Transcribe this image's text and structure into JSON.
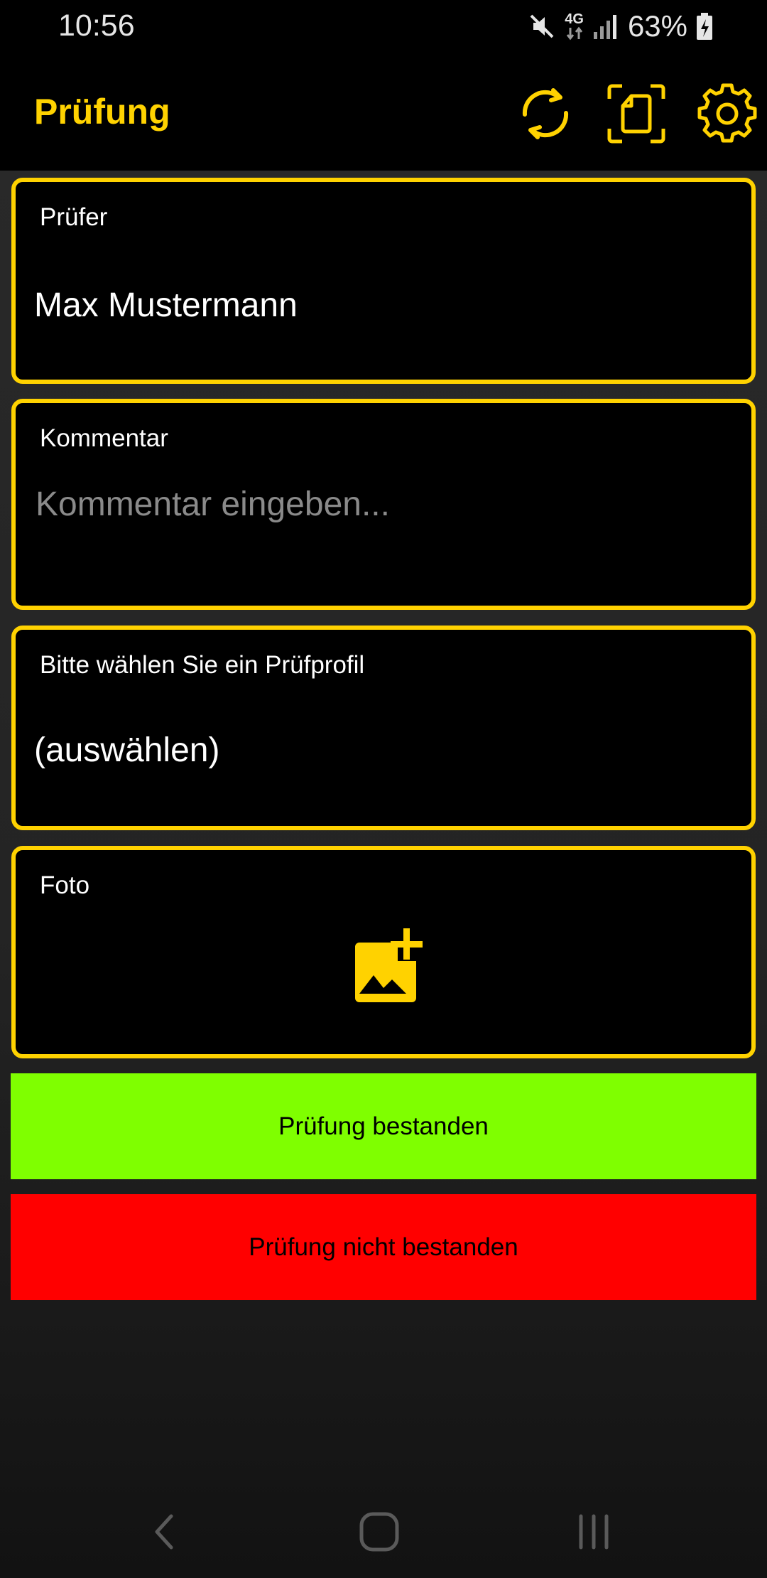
{
  "status_bar": {
    "time": "10:56",
    "network": "4G",
    "battery_percent": "63%",
    "icons": [
      "mute-icon",
      "network-4g-icon",
      "signal-icon",
      "battery-charging-icon"
    ]
  },
  "app_bar": {
    "title": "Prüfung",
    "actions": [
      "sync-icon",
      "document-scan-icon",
      "settings-gear-icon"
    ],
    "accent_color": "#ffd200"
  },
  "form": {
    "examiner": {
      "label": "Prüfer",
      "value": "Max Mustermann"
    },
    "comment": {
      "label": "Kommentar",
      "value": "",
      "placeholder": "Kommentar eingeben..."
    },
    "profile": {
      "label": "Bitte wählen Sie ein Prüfprofil",
      "selected": "(auswählen)"
    },
    "photo": {
      "label": "Foto",
      "icon": "add-photo-icon"
    }
  },
  "actions": {
    "pass_label": "Prüfung bestanden",
    "pass_color": "#7fff00",
    "fail_label": "Prüfung nicht bestanden",
    "fail_color": "#ff0000"
  },
  "nav_bar": {
    "buttons": [
      "back-icon",
      "home-icon",
      "recent-apps-icon"
    ]
  }
}
